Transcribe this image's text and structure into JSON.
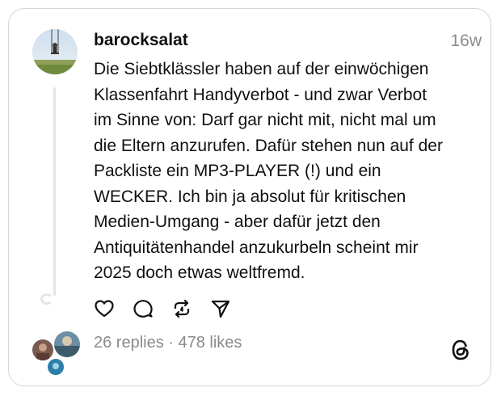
{
  "post": {
    "username": "barocksalat",
    "timestamp": "16w",
    "text": "Die Siebtklässler haben auf der einwöchigen\nKlassenfahrt Handyverbot - und zwar Verbot\nim Sinne von: Darf gar nicht mit, nicht mal um\ndie Eltern anzurufen. Dafür stehen nun auf der\nPackliste ein MP3-PLAYER (!) und ein\nWECKER. Ich bin ja absolut für kritischen\nMedien-Umgang - aber dafür jetzt den\nAntiquitätenhandel anzukurbeln scheint mir\n2025 doch etwas weltfremd.",
    "stats": "26 replies · 478 likes"
  },
  "actions": [
    {
      "name": "like",
      "icon": "heart-icon"
    },
    {
      "name": "reply",
      "icon": "speech-bubble-icon"
    },
    {
      "name": "repost",
      "icon": "repost-icon"
    },
    {
      "name": "share",
      "icon": "send-icon"
    }
  ],
  "colors": {
    "text": "#101010",
    "muted": "#8a8a8a",
    "border": "#d6d6d6",
    "thread_line": "#e5e5e5"
  },
  "brand_icon": "threads-logo-icon"
}
